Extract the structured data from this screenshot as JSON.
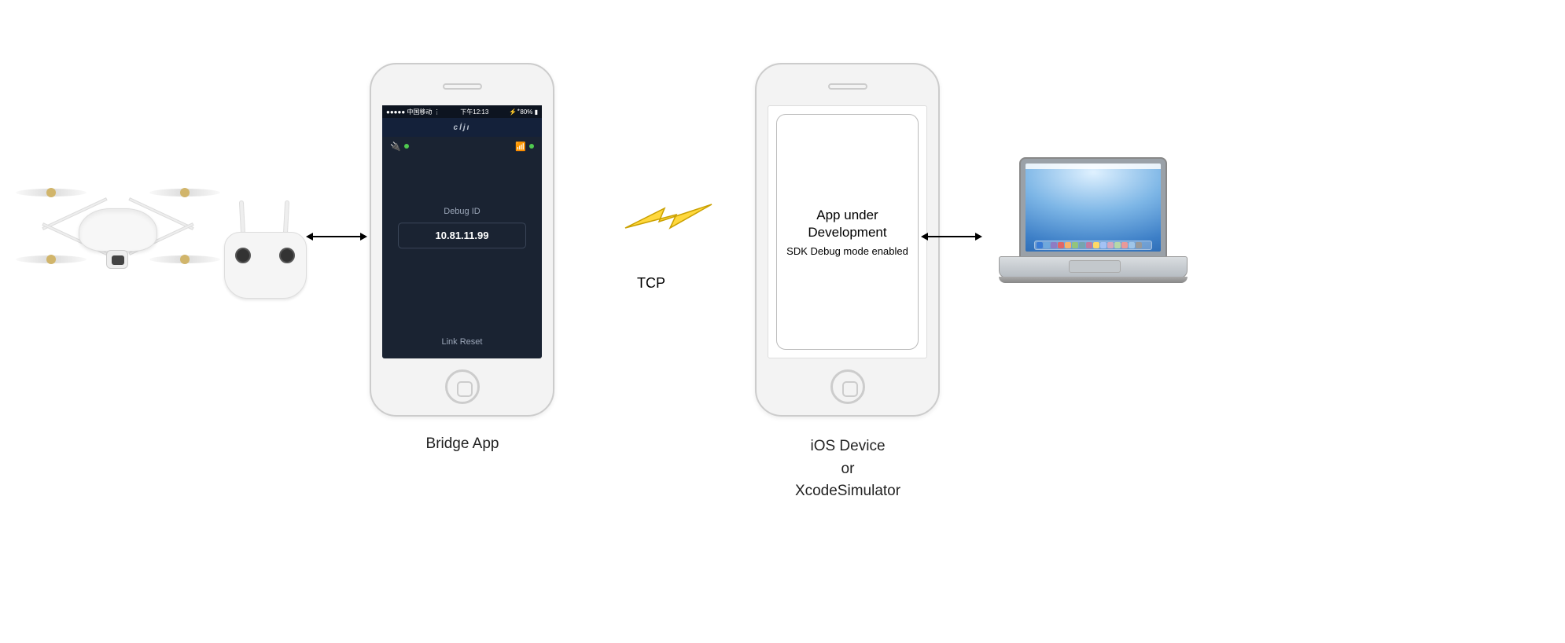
{
  "bridge_phone": {
    "statusbar": {
      "carrier": "●●●●● 中国移动 ⋮",
      "time": "下午12:13",
      "bt_batt": "⚡ ⃰ 80% ▮"
    },
    "brand": "cİjı",
    "debug_label": "Debug ID",
    "debug_ip": "10.81.11.99",
    "link_reset": "Link Reset",
    "caption": "Bridge App"
  },
  "connection": {
    "protocol": "TCP"
  },
  "dev_phone": {
    "title": "App under Development",
    "subtitle": "SDK Debug mode enabled",
    "caption_line1": "iOS Device",
    "caption_line2": "or",
    "caption_line3": "XcodeSimulator"
  }
}
